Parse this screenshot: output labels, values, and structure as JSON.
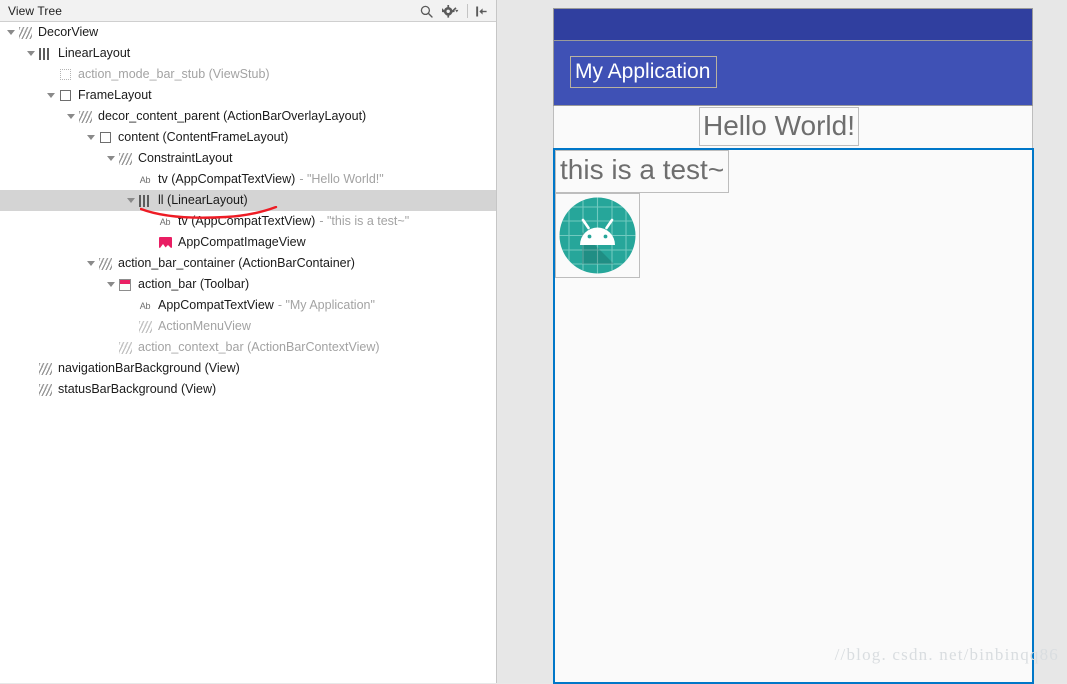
{
  "panel": {
    "title": "View Tree",
    "tools": [
      {
        "name": "search-icon",
        "label": "Search"
      },
      {
        "name": "settings-gear-icon",
        "label": "Settings"
      },
      {
        "name": "collapse-panel-icon",
        "label": "Hide"
      }
    ]
  },
  "tree": [
    {
      "depth": 0,
      "twisty": "down",
      "icon": "hatch",
      "label": "DecorView",
      "value": "",
      "dim": false,
      "selected": false
    },
    {
      "depth": 1,
      "twisty": "down",
      "icon": "bars",
      "label": "LinearLayout",
      "value": "",
      "dim": false,
      "selected": false
    },
    {
      "depth": 2,
      "twisty": "none",
      "icon": "dotted",
      "label": "action_mode_bar_stub (ViewStub)",
      "value": "",
      "dim": true,
      "selected": false
    },
    {
      "depth": 2,
      "twisty": "down",
      "icon": "square",
      "label": "FrameLayout",
      "value": "",
      "dim": false,
      "selected": false
    },
    {
      "depth": 3,
      "twisty": "down",
      "icon": "hatch",
      "label": "decor_content_parent (ActionBarOverlayLayout)",
      "value": "",
      "dim": false,
      "selected": false
    },
    {
      "depth": 4,
      "twisty": "down",
      "icon": "square",
      "label": "content (ContentFrameLayout)",
      "value": "",
      "dim": false,
      "selected": false
    },
    {
      "depth": 5,
      "twisty": "down",
      "icon": "hatch",
      "label": "ConstraintLayout",
      "value": "",
      "dim": false,
      "selected": false
    },
    {
      "depth": 6,
      "twisty": "none",
      "icon": "ab",
      "label": "tv (AppCompatTextView)",
      "value": "- \"Hello World!\"",
      "dim": false,
      "selected": false
    },
    {
      "depth": 6,
      "twisty": "down",
      "icon": "bars",
      "label": "ll (LinearLayout)",
      "value": "",
      "dim": false,
      "selected": true
    },
    {
      "depth": 7,
      "twisty": "none",
      "icon": "ab",
      "label": "tv (AppCompatTextView)",
      "value": "- \"this is a test~\"",
      "dim": false,
      "selected": false
    },
    {
      "depth": 7,
      "twisty": "none",
      "icon": "image",
      "label": "AppCompatImageView",
      "value": "",
      "dim": false,
      "selected": false
    },
    {
      "depth": 4,
      "twisty": "down",
      "icon": "hatch",
      "label": "action_bar_container (ActionBarContainer)",
      "value": "",
      "dim": false,
      "selected": false
    },
    {
      "depth": 5,
      "twisty": "down",
      "icon": "toolbar",
      "label": "action_bar (Toolbar)",
      "value": "",
      "dim": false,
      "selected": false
    },
    {
      "depth": 6,
      "twisty": "none",
      "icon": "ab",
      "label": "AppCompatTextView",
      "value": "- \"My Application\"",
      "dim": false,
      "selected": false
    },
    {
      "depth": 6,
      "twisty": "none",
      "icon": "hatch-dim",
      "label": "ActionMenuView",
      "value": "",
      "dim": true,
      "selected": false
    },
    {
      "depth": 5,
      "twisty": "none",
      "icon": "hatch-dim",
      "label": "action_context_bar (ActionBarContextView)",
      "value": "",
      "dim": true,
      "selected": false
    },
    {
      "depth": 1,
      "twisty": "none",
      "icon": "hatch",
      "label": "navigationBarBackground (View)",
      "value": "",
      "dim": false,
      "selected": false
    },
    {
      "depth": 1,
      "twisty": "none",
      "icon": "hatch",
      "label": "statusBarBackground (View)",
      "value": "",
      "dim": false,
      "selected": false
    }
  ],
  "annotation": {
    "name": "red-underline-annotation",
    "color": "#ee1c25",
    "target": "ll (LinearLayout)"
  },
  "preview": {
    "status_bar_color": "#303F9F",
    "toolbar_color": "#3F51B5",
    "toolbar_title": "My Application",
    "hello_world": "Hello World!",
    "test_text": "this is a test~",
    "app_icon": "android-launcher-icon",
    "selection_color": "#0077C8",
    "watermark": "//blog. csdn. net/binbinqq86"
  }
}
